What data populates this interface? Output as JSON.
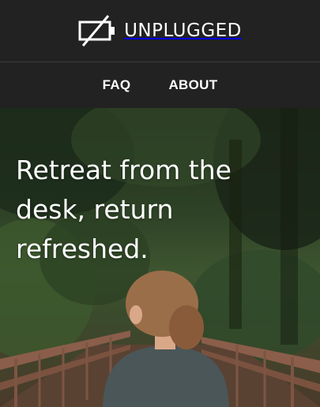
{
  "brand": {
    "name": "UNPLUGGED",
    "logo_icon": "unplugged-battery-icon"
  },
  "nav": {
    "items": [
      {
        "label": "FAQ"
      },
      {
        "label": "ABOUT"
      }
    ]
  },
  "hero": {
    "headline": "Retreat from the desk, return refreshed."
  },
  "colors": {
    "header_bg": "#222222",
    "text": "#ffffff"
  }
}
